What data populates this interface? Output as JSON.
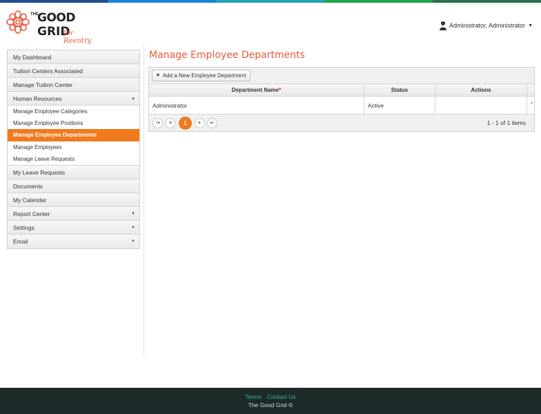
{
  "brand": {
    "the": "THE",
    "good": "GOOD",
    "grid": "GRID",
    "tagline": "for Reentry",
    "colors": [
      "#1f4e8c",
      "#1c86d6",
      "#23a6b3",
      "#20a34a",
      "#2a6f50"
    ],
    "accent": "#e8583a"
  },
  "header": {
    "user_name": "Administrator, Administrator",
    "user_icon": "user-avatar-icon"
  },
  "sidebar": {
    "items": [
      {
        "label": "My Dashboard"
      },
      {
        "label": "Tuition Centers Associated"
      },
      {
        "label": "Manage Tuition Center"
      },
      {
        "label": "Human Resources",
        "expanded": true
      },
      {
        "label": "My Leave Requests"
      },
      {
        "label": "Documents"
      },
      {
        "label": "My Calendar"
      },
      {
        "label": "Report Center"
      },
      {
        "label": "Settings"
      },
      {
        "label": "Email"
      }
    ],
    "hr_sub": [
      {
        "label": "Manage Employee Categories"
      },
      {
        "label": "Manage Employee Positions"
      },
      {
        "label": "Manage Employee Departments",
        "active": true
      },
      {
        "label": "Manage Employees"
      },
      {
        "label": "Manage Leave Requests"
      }
    ]
  },
  "main": {
    "title": "Manage Employee Departments",
    "add_button": "Add a New Employee Department",
    "columns": {
      "name": "Department Name",
      "required_mark": "*",
      "status": "Status",
      "actions": "Actions"
    },
    "rows": [
      {
        "name": "Administrator",
        "status": "Active",
        "actions": ""
      }
    ],
    "pager": {
      "current_page": "1",
      "info": "1 - 1 of 1 items"
    }
  },
  "footer": {
    "terms": "Terms",
    "contact": "Contact Us",
    "copyright": "The Good Grid ©"
  }
}
